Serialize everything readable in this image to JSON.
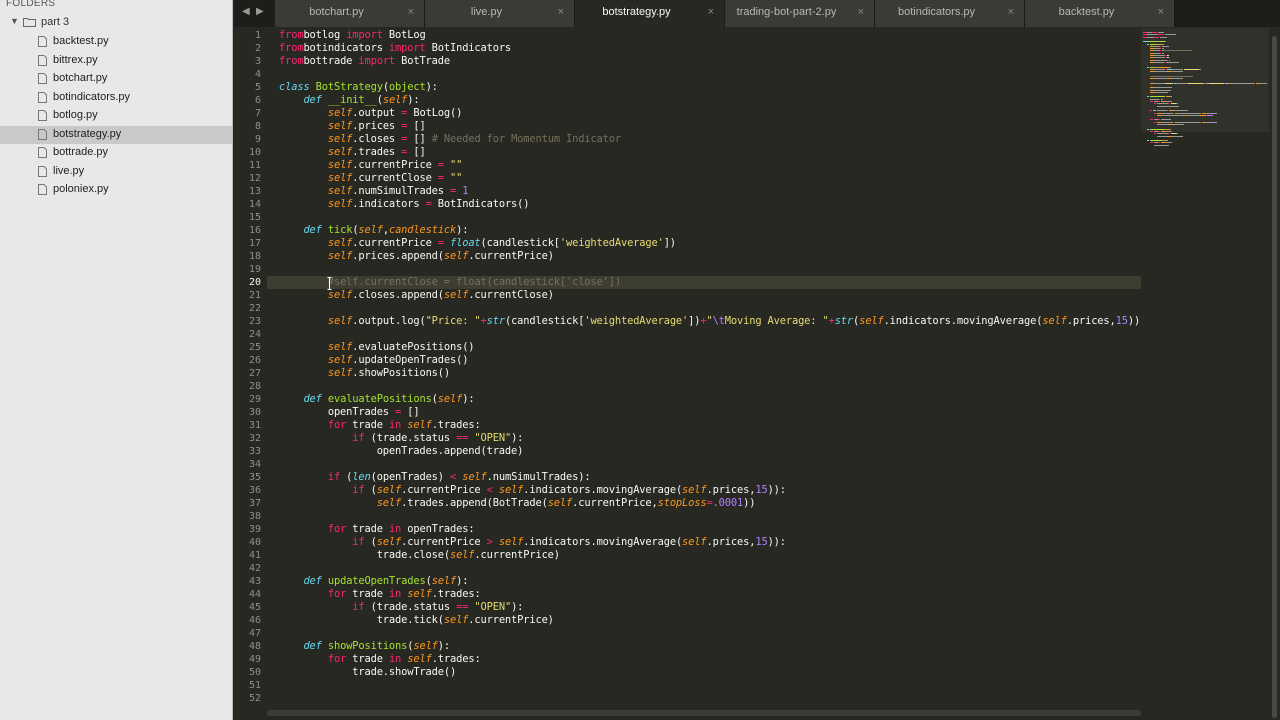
{
  "sidebar": {
    "header": "FOLDERS",
    "folder": "part 3",
    "files": [
      {
        "name": "backtest.py"
      },
      {
        "name": "bittrex.py"
      },
      {
        "name": "botchart.py"
      },
      {
        "name": "botindicators.py"
      },
      {
        "name": "botlog.py"
      },
      {
        "name": "botstrategy.py"
      },
      {
        "name": "bottrade.py"
      },
      {
        "name": "live.py"
      },
      {
        "name": "poloniex.py"
      }
    ],
    "active_file": "botstrategy.py"
  },
  "nav": {
    "back": "◀",
    "forward": "▶"
  },
  "tabs": [
    {
      "label": "botchart.py",
      "close": "×"
    },
    {
      "label": "live.py",
      "close": "×"
    },
    {
      "label": "botstrategy.py",
      "close": "×"
    },
    {
      "label": "trading-bot-part-2.py",
      "close": "×"
    },
    {
      "label": "botindicators.py",
      "close": "×"
    },
    {
      "label": "backtest.py",
      "close": "×"
    }
  ],
  "active_tab": "botstrategy.py",
  "editor": {
    "current_line": 20,
    "lines": [
      [
        [
          "kw",
          "from"
        ],
        [
          "",
          "botlog "
        ],
        [
          "kw",
          "import"
        ],
        [
          "",
          " BotLog"
        ]
      ],
      [
        [
          "kw",
          "from"
        ],
        [
          "",
          "botindicators "
        ],
        [
          "kw",
          "import"
        ],
        [
          "",
          " BotIndicators"
        ]
      ],
      [
        [
          "kw",
          "from"
        ],
        [
          "",
          "bottrade "
        ],
        [
          "kw",
          "import"
        ],
        [
          "",
          " BotTrade"
        ]
      ],
      [],
      [
        [
          "dk",
          "class"
        ],
        [
          "",
          " "
        ],
        [
          "cls",
          "BotStrategy"
        ],
        [
          "",
          "("
        ],
        [
          "cls",
          "object"
        ],
        [
          "",
          "):"
        ]
      ],
      [
        [
          "",
          "    "
        ],
        [
          "dk",
          "def"
        ],
        [
          "",
          " "
        ],
        [
          "fn",
          "__init__"
        ],
        [
          "",
          "("
        ],
        [
          "sf",
          "self"
        ],
        [
          "",
          "):"
        ]
      ],
      [
        [
          "",
          "        "
        ],
        [
          "sf",
          "self"
        ],
        [
          "",
          ".output "
        ],
        [
          "kw",
          "="
        ],
        [
          "",
          " BotLog()"
        ]
      ],
      [
        [
          "",
          "        "
        ],
        [
          "sf",
          "self"
        ],
        [
          "",
          ".prices "
        ],
        [
          "kw",
          "="
        ],
        [
          "",
          " []"
        ]
      ],
      [
        [
          "",
          "        "
        ],
        [
          "sf",
          "self"
        ],
        [
          "",
          ".closes "
        ],
        [
          "kw",
          "="
        ],
        [
          "",
          " [] "
        ],
        [
          "cm",
          "# Needed for Momentum Indicator"
        ]
      ],
      [
        [
          "",
          "        "
        ],
        [
          "sf",
          "self"
        ],
        [
          "",
          ".trades "
        ],
        [
          "kw",
          "="
        ],
        [
          "",
          " []"
        ]
      ],
      [
        [
          "",
          "        "
        ],
        [
          "sf",
          "self"
        ],
        [
          "",
          ".currentPrice "
        ],
        [
          "kw",
          "="
        ],
        [
          "",
          " "
        ],
        [
          "st",
          "\"\""
        ]
      ],
      [
        [
          "",
          "        "
        ],
        [
          "sf",
          "self"
        ],
        [
          "",
          ".currentClose "
        ],
        [
          "kw",
          "="
        ],
        [
          "",
          " "
        ],
        [
          "st",
          "\"\""
        ]
      ],
      [
        [
          "",
          "        "
        ],
        [
          "sf",
          "self"
        ],
        [
          "",
          ".numSimulTrades "
        ],
        [
          "kw",
          "="
        ],
        [
          "",
          " "
        ],
        [
          "nm",
          "1"
        ]
      ],
      [
        [
          "",
          "        "
        ],
        [
          "sf",
          "self"
        ],
        [
          "",
          ".indicators "
        ],
        [
          "kw",
          "="
        ],
        [
          "",
          " BotIndicators()"
        ]
      ],
      [],
      [
        [
          "",
          "    "
        ],
        [
          "dk",
          "def"
        ],
        [
          "",
          " "
        ],
        [
          "fn",
          "tick"
        ],
        [
          "",
          "("
        ],
        [
          "sf",
          "self"
        ],
        [
          "",
          ","
        ],
        [
          "sf",
          "candlestick"
        ],
        [
          "",
          "):"
        ]
      ],
      [
        [
          "",
          "        "
        ],
        [
          "sf",
          "self"
        ],
        [
          "",
          ".currentPrice "
        ],
        [
          "kw",
          "="
        ],
        [
          "",
          " "
        ],
        [
          "bi",
          "float"
        ],
        [
          "",
          "(candlestick["
        ],
        [
          "st",
          "'weightedAverage'"
        ],
        [
          "",
          "])"
        ]
      ],
      [
        [
          "",
          "        "
        ],
        [
          "sf",
          "self"
        ],
        [
          "",
          ".prices.append("
        ],
        [
          "sf",
          "self"
        ],
        [
          "",
          ".currentPrice)"
        ]
      ],
      [],
      [
        [
          "",
          "        "
        ],
        [
          "cm",
          "#self.currentClose = float(candlestick['close'])"
        ]
      ],
      [
        [
          "",
          "        "
        ],
        [
          "sf",
          "self"
        ],
        [
          "",
          ".closes.append("
        ],
        [
          "sf",
          "self"
        ],
        [
          "",
          ".currentClose)"
        ]
      ],
      [],
      [
        [
          "",
          "        "
        ],
        [
          "sf",
          "self"
        ],
        [
          "",
          ".output.log("
        ],
        [
          "st",
          "\"Price: \""
        ],
        [
          "kw",
          "+"
        ],
        [
          "bi",
          "str"
        ],
        [
          "",
          "(candlestick["
        ],
        [
          "st",
          "'weightedAverage'"
        ],
        [
          "",
          "])"
        ],
        [
          "kw",
          "+"
        ],
        [
          "st",
          "\""
        ],
        [
          "es",
          "\\t"
        ],
        [
          "st",
          "Moving Average: \""
        ],
        [
          "kw",
          "+"
        ],
        [
          "bi",
          "str"
        ],
        [
          "",
          "("
        ],
        [
          "sf",
          "self"
        ],
        [
          "",
          ".indicators.movingAverage("
        ],
        [
          "sf",
          "self"
        ],
        [
          "",
          ".prices,"
        ],
        [
          "nm",
          "15"
        ],
        [
          "",
          "))"
        ]
      ],
      [],
      [
        [
          "",
          "        "
        ],
        [
          "sf",
          "self"
        ],
        [
          "",
          ".evaluatePositions()"
        ]
      ],
      [
        [
          "",
          "        "
        ],
        [
          "sf",
          "self"
        ],
        [
          "",
          ".updateOpenTrades()"
        ]
      ],
      [
        [
          "",
          "        "
        ],
        [
          "sf",
          "self"
        ],
        [
          "",
          ".showPositions()"
        ]
      ],
      [],
      [
        [
          "",
          "    "
        ],
        [
          "dk",
          "def"
        ],
        [
          "",
          " "
        ],
        [
          "fn",
          "evaluatePositions"
        ],
        [
          "",
          "("
        ],
        [
          "sf",
          "self"
        ],
        [
          "",
          "):"
        ]
      ],
      [
        [
          "",
          "        openTrades "
        ],
        [
          "kw",
          "="
        ],
        [
          "",
          " []"
        ]
      ],
      [
        [
          "",
          "        "
        ],
        [
          "kw",
          "for"
        ],
        [
          "",
          " trade "
        ],
        [
          "kw",
          "in"
        ],
        [
          "",
          " "
        ],
        [
          "sf",
          "self"
        ],
        [
          "",
          ".trades:"
        ]
      ],
      [
        [
          "",
          "            "
        ],
        [
          "kw",
          "if"
        ],
        [
          "",
          " (trade.status "
        ],
        [
          "kw",
          "=="
        ],
        [
          "",
          " "
        ],
        [
          "st",
          "\"OPEN\""
        ],
        [
          "",
          "):"
        ]
      ],
      [
        [
          "",
          "                openTrades.append(trade)"
        ]
      ],
      [],
      [
        [
          "",
          "        "
        ],
        [
          "kw",
          "if"
        ],
        [
          "",
          " ("
        ],
        [
          "bi",
          "len"
        ],
        [
          "",
          "(openTrades) "
        ],
        [
          "kw",
          "<"
        ],
        [
          "",
          " "
        ],
        [
          "sf",
          "self"
        ],
        [
          "",
          ".numSimulTrades):"
        ]
      ],
      [
        [
          "",
          "            "
        ],
        [
          "kw",
          "if"
        ],
        [
          "",
          " ("
        ],
        [
          "sf",
          "self"
        ],
        [
          "",
          ".currentPrice "
        ],
        [
          "kw",
          "<"
        ],
        [
          "",
          " "
        ],
        [
          "sf",
          "self"
        ],
        [
          "",
          ".indicators.movingAverage("
        ],
        [
          "sf",
          "self"
        ],
        [
          "",
          ".prices,"
        ],
        [
          "nm",
          "15"
        ],
        [
          "",
          ")):"
        ]
      ],
      [
        [
          "",
          "                "
        ],
        [
          "sf",
          "self"
        ],
        [
          "",
          ".trades.append(BotTrade("
        ],
        [
          "sf",
          "self"
        ],
        [
          "",
          ".currentPrice,"
        ],
        [
          "sf",
          "stopLoss"
        ],
        [
          "kw",
          "="
        ],
        [
          "nm",
          ".0001"
        ],
        [
          "",
          "))"
        ]
      ],
      [],
      [
        [
          "",
          "        "
        ],
        [
          "kw",
          "for"
        ],
        [
          "",
          " trade "
        ],
        [
          "kw",
          "in"
        ],
        [
          "",
          " openTrades:"
        ]
      ],
      [
        [
          "",
          "            "
        ],
        [
          "kw",
          "if"
        ],
        [
          "",
          " ("
        ],
        [
          "sf",
          "self"
        ],
        [
          "",
          ".currentPrice "
        ],
        [
          "kw",
          ">"
        ],
        [
          "",
          " "
        ],
        [
          "sf",
          "self"
        ],
        [
          "",
          ".indicators.movingAverage("
        ],
        [
          "sf",
          "self"
        ],
        [
          "",
          ".prices,"
        ],
        [
          "nm",
          "15"
        ],
        [
          "",
          ")):"
        ]
      ],
      [
        [
          "",
          "                trade.close("
        ],
        [
          "sf",
          "self"
        ],
        [
          "",
          ".currentPrice)"
        ]
      ],
      [],
      [
        [
          "",
          "    "
        ],
        [
          "dk",
          "def"
        ],
        [
          "",
          " "
        ],
        [
          "fn",
          "updateOpenTrades"
        ],
        [
          "",
          "("
        ],
        [
          "sf",
          "self"
        ],
        [
          "",
          "):"
        ]
      ],
      [
        [
          "",
          "        "
        ],
        [
          "kw",
          "for"
        ],
        [
          "",
          " trade "
        ],
        [
          "kw",
          "in"
        ],
        [
          "",
          " "
        ],
        [
          "sf",
          "self"
        ],
        [
          "",
          ".trades:"
        ]
      ],
      [
        [
          "",
          "            "
        ],
        [
          "kw",
          "if"
        ],
        [
          "",
          " (trade.status "
        ],
        [
          "kw",
          "=="
        ],
        [
          "",
          " "
        ],
        [
          "st",
          "\"OPEN\""
        ],
        [
          "",
          "):"
        ]
      ],
      [
        [
          "",
          "                trade.tick("
        ],
        [
          "sf",
          "self"
        ],
        [
          "",
          ".currentPrice)"
        ]
      ],
      [],
      [
        [
          "",
          "    "
        ],
        [
          "dk",
          "def"
        ],
        [
          "",
          " "
        ],
        [
          "fn",
          "showPositions"
        ],
        [
          "",
          "("
        ],
        [
          "sf",
          "self"
        ],
        [
          "",
          "):"
        ]
      ],
      [
        [
          "",
          "        "
        ],
        [
          "kw",
          "for"
        ],
        [
          "",
          " trade "
        ],
        [
          "kw",
          "in"
        ],
        [
          "",
          " "
        ],
        [
          "sf",
          "self"
        ],
        [
          "",
          ".trades:"
        ]
      ],
      [
        [
          "",
          "            trade.showTrade()"
        ]
      ],
      [],
      []
    ]
  },
  "colors": {
    "background": "#272822",
    "keyword": "#f92672",
    "self": "#fd971f",
    "function": "#a6e22e",
    "string": "#e6db74",
    "number": "#ae81ff",
    "comment": "#75715e",
    "builtin": "#66d9ef",
    "sidebar_bg": "#e8e8e8"
  }
}
